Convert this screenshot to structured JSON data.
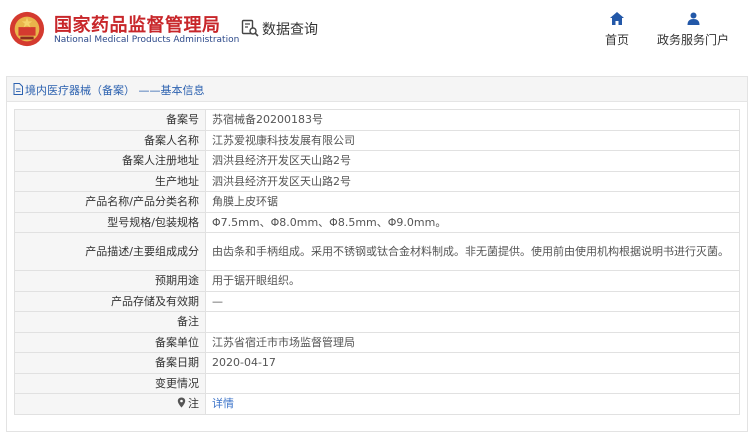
{
  "header": {
    "brand_cn": "国家药品监督管理局",
    "brand_en": "National Medical Products Administration",
    "section_title": "数据查询",
    "nav": {
      "home": "首页",
      "portal": "政务服务门户"
    }
  },
  "panel": {
    "title": "境内医疗器械（备案） ——基本信息"
  },
  "record": [
    {
      "label": "备案号",
      "value": "苏宿械备20200183号"
    },
    {
      "label": "备案人名称",
      "value": "江苏爱视康科技发展有限公司"
    },
    {
      "label": "备案人注册地址",
      "value": "泗洪县经济开发区天山路2号"
    },
    {
      "label": "生产地址",
      "value": "泗洪县经济开发区天山路2号"
    },
    {
      "label": "产品名称/产品分类名称",
      "value": "角膜上皮环锯"
    },
    {
      "label": "型号规格/包装规格",
      "value": "Φ7.5mm、Φ8.0mm、Φ8.5mm、Φ9.0mm。"
    },
    {
      "label": "产品描述/主要组成成分",
      "value": "由齿条和手柄组成。采用不锈钢或钛合金材料制成。非无菌提供。使用前由使用机构根据说明书进行灭菌。"
    },
    {
      "label": "预期用途",
      "value": "用于锯开眼组织。"
    },
    {
      "label": "产品存储及有效期",
      "value": "—"
    },
    {
      "label": "备注",
      "value": ""
    },
    {
      "label": "备案单位",
      "value": "江苏省宿迁市市场监督管理局"
    },
    {
      "label": "备案日期",
      "value": "2020-04-17"
    },
    {
      "label": "变更情况",
      "value": ""
    },
    {
      "label": "注",
      "value": "详情"
    }
  ],
  "colors": {
    "brand_red": "#c8262a",
    "brand_blue": "#2d4a8a",
    "link_blue": "#3a72c8",
    "nav_icon_blue": "#2358a8"
  }
}
